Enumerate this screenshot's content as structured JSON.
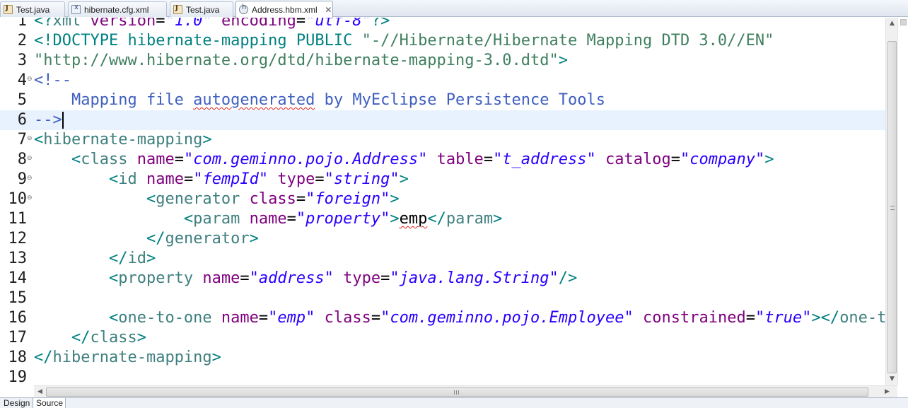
{
  "tabs": [
    {
      "label": "Test.java",
      "icon": "java-file-icon",
      "active": false
    },
    {
      "label": "hibernate.cfg.xml",
      "icon": "xml-file-icon",
      "active": false
    },
    {
      "label": "Test.java",
      "icon": "java-file-icon",
      "active": false
    },
    {
      "label": "Address.hbm.xml",
      "icon": "hibernate-mapping-file-icon",
      "active": true,
      "close": "✕"
    }
  ],
  "editor": {
    "current_line": 6,
    "lines": [
      {
        "num": "1",
        "fold": ""
      },
      {
        "num": "2",
        "fold": ""
      },
      {
        "num": "3",
        "fold": ""
      },
      {
        "num": "4",
        "fold": "⊖"
      },
      {
        "num": "5",
        "fold": ""
      },
      {
        "num": "6",
        "fold": ""
      },
      {
        "num": "7",
        "fold": "⊖"
      },
      {
        "num": "8",
        "fold": "⊖"
      },
      {
        "num": "9",
        "fold": "⊖"
      },
      {
        "num": "10",
        "fold": "⊖"
      },
      {
        "num": "11",
        "fold": ""
      },
      {
        "num": "12",
        "fold": ""
      },
      {
        "num": "13",
        "fold": ""
      },
      {
        "num": "14",
        "fold": ""
      },
      {
        "num": "15",
        "fold": ""
      },
      {
        "num": "16",
        "fold": ""
      },
      {
        "num": "17",
        "fold": ""
      },
      {
        "num": "18",
        "fold": ""
      },
      {
        "num": "19",
        "fold": ""
      }
    ],
    "tokens": {
      "l1": [
        "<?",
        "xml",
        " version",
        "=",
        "\"1.0\"",
        " encoding",
        "=",
        "\"utf-8\"",
        "?>"
      ],
      "l2": [
        "<!",
        "DOCTYPE",
        " hibernate-mapping",
        " PUBLIC",
        " \"-//Hibernate/Hibernate Mapping DTD 3.0//EN\""
      ],
      "l3": [
        "\"http://www.hibernate.org/dtd/hibernate-mapping-3.0.dtd\"",
        ">"
      ],
      "l4": [
        "<!--"
      ],
      "l5": [
        "    Mapping file ",
        "autogenerated",
        " by MyEclipse Persistence Tools"
      ],
      "l6": [
        "-->"
      ],
      "l7": [
        "<",
        "hibernate-mapping",
        ">"
      ],
      "l8": [
        "    ",
        "<",
        "class",
        " name",
        "=",
        "\"com.geminno.pojo.Address\"",
        " table",
        "=",
        "\"t_address\"",
        " catalog",
        "=",
        "\"company\"",
        ">"
      ],
      "l9": [
        "        ",
        "<",
        "id",
        " name",
        "=",
        "\"fempId\"",
        " type",
        "=",
        "\"string\"",
        ">"
      ],
      "l10": [
        "            ",
        "<",
        "generator",
        " class",
        "=",
        "\"foreign\"",
        ">"
      ],
      "l11": [
        "                ",
        "<",
        "param",
        " name",
        "=",
        "\"property\"",
        ">",
        "emp",
        "</",
        "param",
        ">"
      ],
      "l12": [
        "            ",
        "</",
        "generator",
        ">"
      ],
      "l13": [
        "        ",
        "</",
        "id",
        ">"
      ],
      "l14": [
        "        ",
        "<",
        "property",
        " name",
        "=",
        "\"address\"",
        " type",
        "=",
        "\"java.lang.String\"",
        "/>"
      ],
      "l15": [
        ""
      ],
      "l16": [
        "        ",
        "<",
        "one-to-one",
        " name",
        "=",
        "\"emp\"",
        " class",
        "=",
        "\"com.geminno.pojo.Employee\"",
        " constrained",
        "=",
        "\"true\"",
        "></",
        "one-to-one",
        ">"
      ],
      "l17": [
        "    ",
        "</",
        "class",
        ">"
      ],
      "l18": [
        "</",
        "hibernate-mapping",
        ">"
      ],
      "l19": [
        ""
      ]
    }
  },
  "scrollbars": {
    "up_arrow": "▲",
    "down_arrow": "▼",
    "left_arrow": "◀",
    "right_arrow": "▶"
  },
  "bottom_tabs": [
    {
      "label": "Design",
      "active": false
    },
    {
      "label": "Source",
      "active": true
    }
  ],
  "colors": {
    "tag": "#3f7f7f",
    "attribute": "#7f007f",
    "string": "#2a00ff",
    "comment": "#3f5fbf",
    "current_line": "#e8f2fe"
  }
}
